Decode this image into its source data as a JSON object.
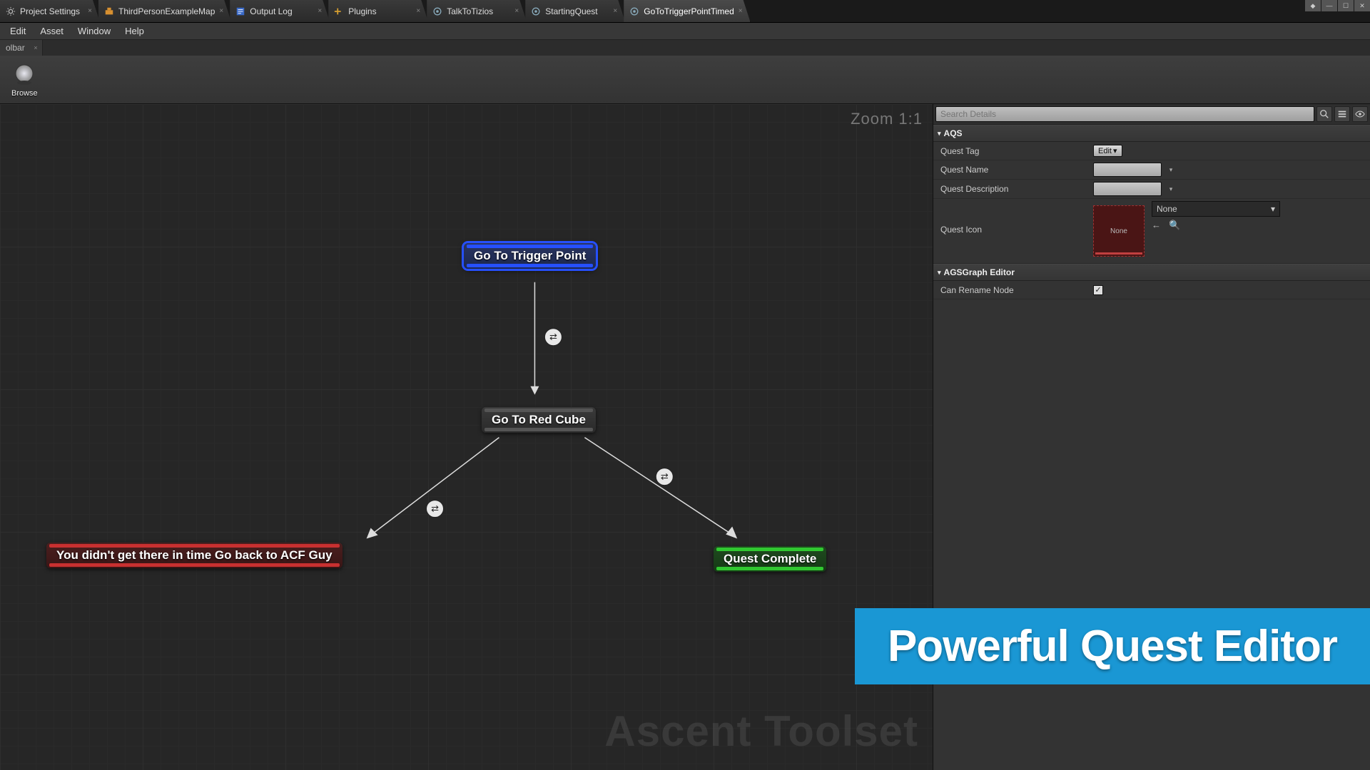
{
  "tabs": [
    {
      "label": "Project Settings",
      "icon": "gear"
    },
    {
      "label": "ThirdPersonExampleMap",
      "icon": "level"
    },
    {
      "label": "Output Log",
      "icon": "log"
    },
    {
      "label": "Plugins",
      "icon": "plugin"
    },
    {
      "label": "TalkToTizios",
      "icon": "asset"
    },
    {
      "label": "StartingQuest",
      "icon": "asset"
    },
    {
      "label": "GoToTriggerPointTimed",
      "icon": "asset",
      "active": true
    }
  ],
  "menu": [
    "Edit",
    "Asset",
    "Window",
    "Help"
  ],
  "toolbar_tab": "olbar",
  "toolbar": {
    "browse": "Browse"
  },
  "graph": {
    "zoom": "Zoom 1:1",
    "watermark": "Ascent Toolset",
    "nodes": {
      "start": {
        "label": "Go To Trigger Point"
      },
      "mid": {
        "label": "Go To Red Cube"
      },
      "fail": {
        "label": "You didn't get there in time Go back to ACF Guy"
      },
      "success": {
        "label": "Quest Complete"
      }
    }
  },
  "details": {
    "search_placeholder": "Search Details",
    "sections": {
      "aqs": {
        "title": "AQS",
        "quest_tag_label": "Quest Tag",
        "quest_tag_btn": "Edit",
        "quest_name_label": "Quest Name",
        "quest_desc_label": "Quest Description",
        "quest_icon_label": "Quest Icon",
        "quest_icon_thumb": "None",
        "quest_icon_dd": "None"
      },
      "graph_editor": {
        "title": "AGSGraph Editor",
        "can_rename_label": "Can Rename Node",
        "can_rename_checked": true
      }
    }
  },
  "banner": "Powerful Quest Editor"
}
